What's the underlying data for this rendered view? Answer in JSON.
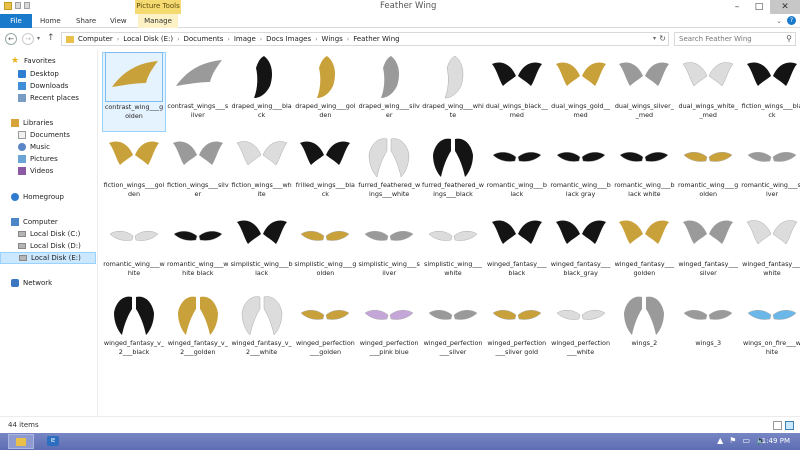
{
  "titlebar": {
    "title": "Feather Wing",
    "contextual_group": "Picture Tools",
    "minimize": "–",
    "maximize": "□",
    "close": "✕"
  },
  "ribbon": {
    "tabs": [
      "File",
      "Home",
      "Share",
      "View",
      "Manage"
    ],
    "expand": "⌄",
    "help": "?"
  },
  "nav": {
    "back": "←",
    "forward": "→",
    "recent": "▾",
    "up": "↑",
    "breadcrumb": [
      "Computer",
      "Local Disk (E:)",
      "Documents",
      "Image",
      "Docs Images",
      "Wings",
      "Feather Wing"
    ],
    "separator": "›",
    "dropdown": "▾",
    "refresh": "↻"
  },
  "search": {
    "placeholder": "Search Feather Wing",
    "icon": "⚲"
  },
  "sidebar": {
    "favorites": {
      "label": "Favorites",
      "items": [
        "Desktop",
        "Downloads",
        "Recent places"
      ]
    },
    "libraries": {
      "label": "Libraries",
      "items": [
        "Documents",
        "Music",
        "Pictures",
        "Videos"
      ]
    },
    "homegroup": "Homegroup",
    "computer": {
      "label": "Computer",
      "items": [
        "Local Disk (C:)",
        "Local Disk (D:)",
        "Local Disk (E:)"
      ]
    },
    "network": "Network"
  },
  "files": [
    {
      "name": "contrast_wing___golden",
      "style": "single-gold"
    },
    {
      "name": "contrast_wings___silver",
      "style": "single-silver"
    },
    {
      "name": "draped_wing___black",
      "style": "tall-black"
    },
    {
      "name": "draped_wing___golden",
      "style": "tall-gold"
    },
    {
      "name": "draped_wing___silver",
      "style": "tall-silver"
    },
    {
      "name": "draped_wing___white",
      "style": "tall-white"
    },
    {
      "name": "dual_wings_black__med",
      "style": "pair-black"
    },
    {
      "name": "dual_wings_gold__med",
      "style": "pair-gold"
    },
    {
      "name": "dual_wings_silver__med",
      "style": "pair-silver"
    },
    {
      "name": "dual_wings_white__med",
      "style": "pair-white"
    },
    {
      "name": "fiction_wings___black",
      "style": "pair-black"
    },
    {
      "name": "fiction_wings___golden",
      "style": "pair-gold"
    },
    {
      "name": "fiction_wings___silver",
      "style": "pair-silver"
    },
    {
      "name": "fiction_wings___white",
      "style": "pair-white"
    },
    {
      "name": "frilled_wings___black",
      "style": "pair-black"
    },
    {
      "name": "furred_feathered_wings___white",
      "style": "tallpair-white"
    },
    {
      "name": "furred_feathered_wings___black",
      "style": "tallpair-black"
    },
    {
      "name": "romantic_wing___black",
      "style": "flat-black"
    },
    {
      "name": "romantic_wing___black gray",
      "style": "flat-black"
    },
    {
      "name": "romantic_wing___black white",
      "style": "flat-black"
    },
    {
      "name": "romantic_wing___golden",
      "style": "flat-gold"
    },
    {
      "name": "romantic_wing___silver",
      "style": "flat-silver"
    },
    {
      "name": "romantic_wing___white",
      "style": "flat-white"
    },
    {
      "name": "romantic_wing___white black",
      "style": "flat-black"
    },
    {
      "name": "simplistic_wing___black",
      "style": "pair-black"
    },
    {
      "name": "simplistic_wing___golden",
      "style": "flat-gold"
    },
    {
      "name": "simplistic_wing___silver",
      "style": "flat-silver"
    },
    {
      "name": "simplistic_wing___white",
      "style": "flat-white"
    },
    {
      "name": "winged_fantasy___black",
      "style": "pair-black"
    },
    {
      "name": "winged_fantasy___black_gray",
      "style": "pair-black"
    },
    {
      "name": "winged_fantasy___golden",
      "style": "pair-gold"
    },
    {
      "name": "winged_fantasy___silver",
      "style": "pair-silver"
    },
    {
      "name": "winged_fantasy___white",
      "style": "pair-white"
    },
    {
      "name": "winged_fantasy_v_2___black",
      "style": "tallpair-black"
    },
    {
      "name": "winged_fantasy_v_2___golden",
      "style": "tallpair-gold"
    },
    {
      "name": "winged_fantasy_v_2___white",
      "style": "tallpair-white"
    },
    {
      "name": "winged_perfection___golden",
      "style": "flat-gold"
    },
    {
      "name": "winged_perfection___pink blue",
      "style": "flat-pink"
    },
    {
      "name": "winged_perfection___silver",
      "style": "flat-silver"
    },
    {
      "name": "winged_perfection___silver gold",
      "style": "flat-gold"
    },
    {
      "name": "winged_perfection___white",
      "style": "flat-white"
    },
    {
      "name": "wings_2",
      "style": "tallpair-silver"
    },
    {
      "name": "wings_3",
      "style": "flat-silver"
    },
    {
      "name": "wings_on_fire___white",
      "style": "flat-blue"
    }
  ],
  "selected_file": "contrast_wing___golden",
  "colors": {
    "black": "#141414",
    "gold": "#c9a13a",
    "silver": "#9a9a9a",
    "white": "#dcdcdc",
    "pink": "#c4a6d8",
    "blue": "#6ab7e8",
    "accent": "#1979ca",
    "selection": "#cce8ff"
  },
  "status": {
    "item_count": "44 items"
  },
  "taskbar": {
    "app_label": "IE",
    "tray_icons": [
      "▲",
      "⚑",
      "▭",
      "🔈"
    ],
    "time": "1:49 PM"
  }
}
